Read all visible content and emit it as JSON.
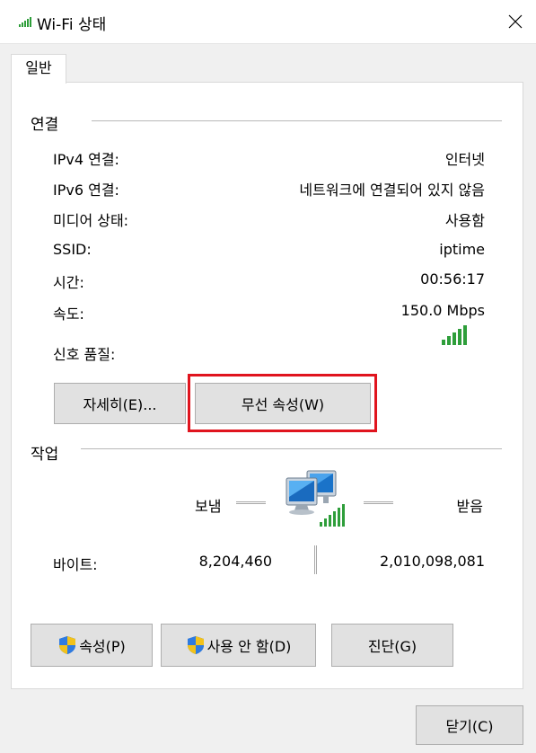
{
  "window": {
    "title": "Wi-Fi 상태"
  },
  "tabs": [
    {
      "label": "일반"
    }
  ],
  "connection": {
    "section_title": "연결",
    "rows": [
      {
        "label": "IPv4 연결:",
        "value": "인터넷"
      },
      {
        "label": "IPv6 연결:",
        "value": "네트워크에 연결되어 있지 않음"
      },
      {
        "label": "미디어 상태:",
        "value": "사용함"
      },
      {
        "label": "SSID:",
        "value": "iptime"
      },
      {
        "label": "시간:",
        "value": "00:56:17"
      },
      {
        "label": "속도:",
        "value": "150.0 Mbps"
      }
    ],
    "signal_label": "신호 품질:",
    "signal_bars": 5,
    "signal_bars_max": 5,
    "details_button": "자세히(E)...",
    "wireless_properties_button": "무선 속성(W)"
  },
  "activity": {
    "section_title": "작업",
    "sent_label": "보냄",
    "received_label": "받음",
    "bytes_label": "바이트:",
    "bytes_sent": "8,204,460",
    "bytes_received": "2,010,098,081"
  },
  "actions": {
    "properties_button": "속성(P)",
    "disable_button": "사용 안 함(D)",
    "diagnose_button": "진단(G)"
  },
  "footer": {
    "close_button": "닫기(C)"
  },
  "colors": {
    "highlight": "#e0141e",
    "signal_green": "#2e9e3a"
  },
  "icons": {
    "title": "wifi-signal-icon",
    "close": "close-icon",
    "signal": "signal-strength-icon",
    "network": "network-computers-icon",
    "shield": "uac-shield-icon"
  }
}
